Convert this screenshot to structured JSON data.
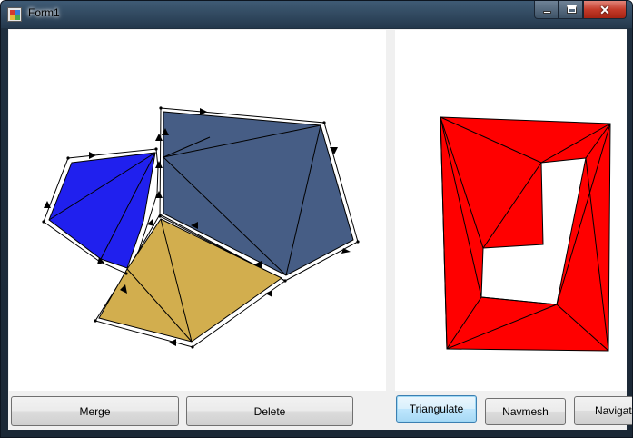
{
  "window": {
    "title": "Form1"
  },
  "buttons": {
    "merge": "Merge",
    "delete": "Delete",
    "triangulate": "Triangulate",
    "navmesh": "Navmesh",
    "navigate": "Navigate"
  },
  "colors": {
    "blue_polygon": "#2020ee",
    "slate_polygon": "#465d85",
    "gold_polygon": "#d2ae4e",
    "red_navmesh": "#ff0000",
    "outline": "#000000"
  },
  "icons": {
    "app": "form-app-icon",
    "minimize": "minimize-icon",
    "maximize": "maximize-icon",
    "close": "close-icon"
  }
}
